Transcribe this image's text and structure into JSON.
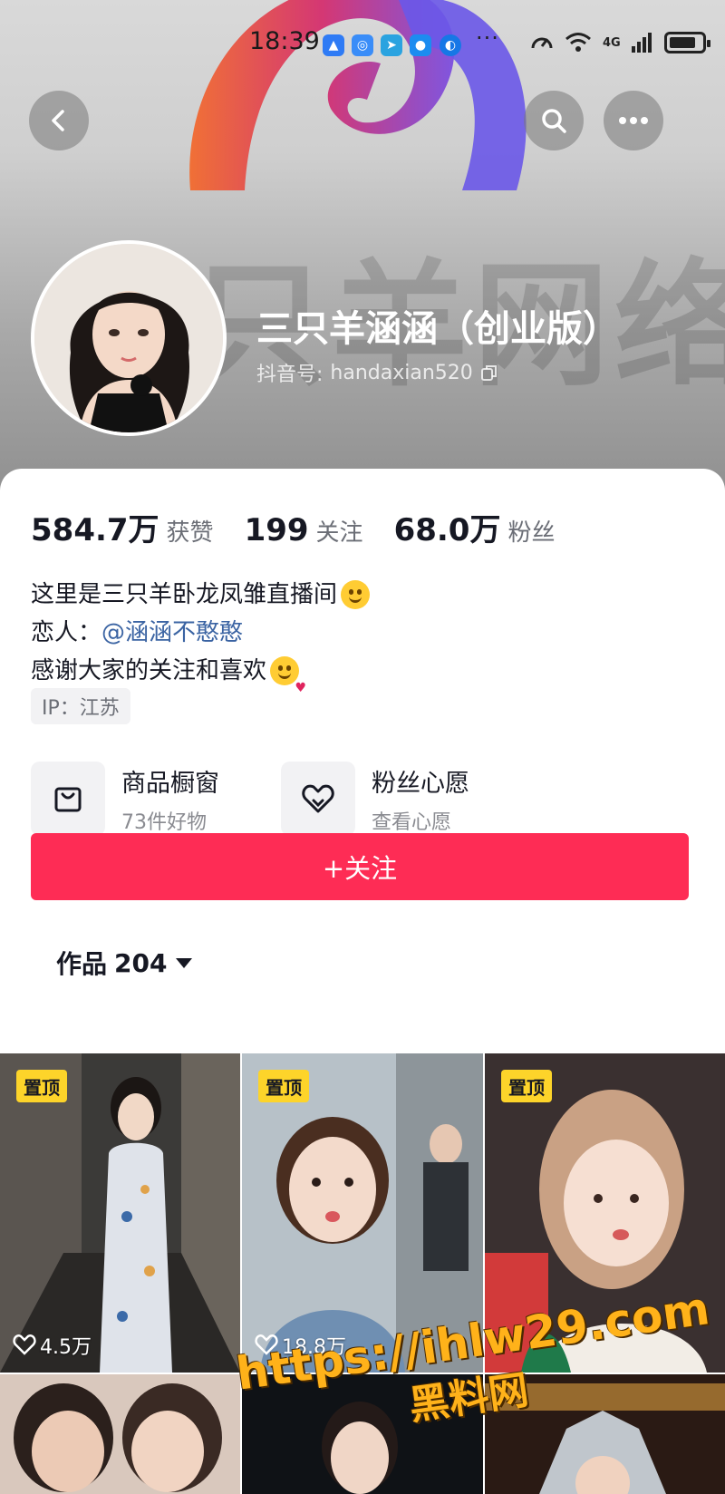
{
  "status_bar": {
    "time": "18:39",
    "more": "···",
    "network": "4G"
  },
  "header": {
    "banner_watermark": "只羊网络",
    "back_icon": "back-arrow-icon",
    "search_icon": "search-icon",
    "more_icon": "more-dots-icon"
  },
  "profile": {
    "nickname": "三只羊涵涵（创业版）",
    "douyin_id_label": "抖音号:",
    "douyin_id": "handaxian520"
  },
  "stats": [
    {
      "value": "584.7万",
      "label": "获赞"
    },
    {
      "value": "199",
      "label": "关注"
    },
    {
      "value": "68.0万",
      "label": "粉丝"
    }
  ],
  "bio": {
    "line1": "这里是三只羊卧龙凤雏直播间",
    "line2_prefix": "恋人：",
    "line2_mention": "@涵涵不憨憨",
    "line3": "感谢大家的关注和喜欢"
  },
  "ip_tag": "IP：江苏",
  "entries": [
    {
      "title": "商品橱窗",
      "subtitle": "73件好物",
      "icon": "bag-icon"
    },
    {
      "title": "粉丝心愿",
      "subtitle": "查看心愿",
      "icon": "heart-wish-icon"
    }
  ],
  "follow_button": "+关注",
  "works_tab": {
    "label": "作品",
    "count": "204"
  },
  "videos": [
    {
      "pinned": "置顶",
      "likes": "4.5万"
    },
    {
      "pinned": "置顶",
      "likes": "18.8万"
    },
    {
      "pinned": "置顶",
      "likes": ""
    }
  ],
  "watermark": {
    "url": "https://ihlw29.com",
    "name": "黑料网"
  },
  "colors": {
    "accent": "#fe2c55",
    "mention": "#3b64a3",
    "pin_badge": "#fdd42a"
  }
}
